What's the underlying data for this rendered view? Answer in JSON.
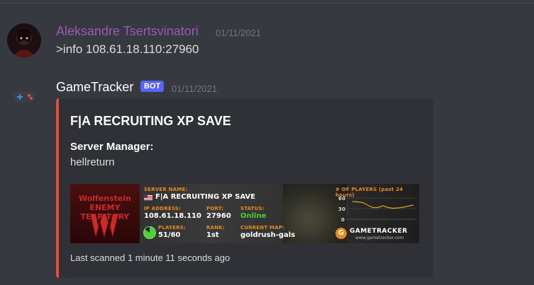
{
  "messages": [
    {
      "username": "Aleksandre Tsertsvinatori",
      "username_color": "#9b59b6",
      "timestamp": "01/11/2021",
      "content": ">info 108.61.18.110:27960",
      "avatar_icon": "user-avatar"
    },
    {
      "username": "GameTracker",
      "username_color": "#ffffff",
      "bot_tag": "BOT",
      "timestamp": "01/11/2021",
      "avatar_icon": "gamepad-icon",
      "embed": {
        "accent_color": "#e74c3c",
        "title": "F|A RECRUITING XP SAVE",
        "field_name": "Server Manager:",
        "field_value": "hellreturn",
        "footer": "Last scanned 1 minute 11 seconds ago",
        "banner": {
          "logo_text": "Wolfenstein ENEMY TERRITORY",
          "server_name_label": "SERVER NAME:",
          "server_name": "F|A RECRUITING XP SAVE",
          "ip_label": "IP ADDRESS:",
          "ip": "108.61.18.110",
          "port_label": "PORT:",
          "port": "27960",
          "status_label": "STATUS:",
          "status": "Online",
          "players_label": "PLAYERS:",
          "players": "51/60",
          "players_fraction": 0.85,
          "rank_label": "RANK:",
          "rank": "1st",
          "map_label": "CURRENT MAP:",
          "map": "goldrush-gals",
          "graph_title": "# OF PLAYERS (past 24 hours)",
          "graph_y_ticks": [
            "60",
            "30",
            "0"
          ],
          "graph_values": [
            50,
            49,
            47,
            40,
            33,
            33,
            38,
            33,
            31,
            32,
            34,
            37,
            40
          ],
          "graph_ylim": [
            0,
            60
          ],
          "brand": "GAMETRACKER",
          "brand_url": "www.gametracker.com"
        }
      }
    }
  ]
}
